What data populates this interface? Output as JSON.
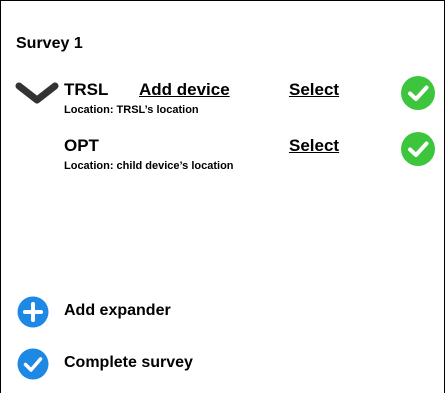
{
  "survey": {
    "title": "Survey 1"
  },
  "devices": [
    {
      "name": "TRSL",
      "location": "Location: TRSL’s location",
      "add_label": "Add device",
      "select_label": "Select",
      "expand_icon": "chevron-down-icon",
      "status_icon": "check-circle-icon"
    },
    {
      "name": "OPT",
      "location": "Location: child device’s location",
      "select_label": "Select",
      "status_icon": "check-circle-icon"
    }
  ],
  "actions": {
    "add_expander": {
      "label": "Add expander",
      "icon": "plus-circle-icon"
    },
    "complete_survey": {
      "label": "Complete survey",
      "icon": "check-circle-icon"
    }
  },
  "colors": {
    "check_green": "#3ec53e",
    "action_blue": "#1e88e5",
    "chevron_gray": "#333333"
  }
}
